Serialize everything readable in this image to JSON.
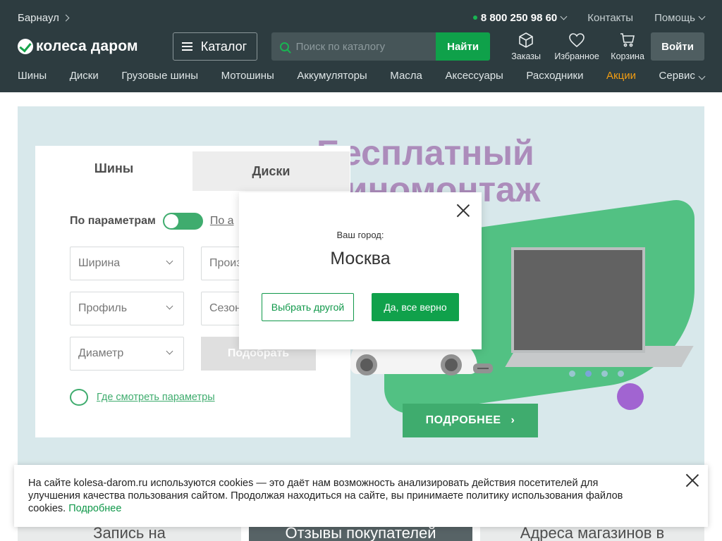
{
  "header": {
    "city": "Барнаул",
    "phone": "8 800 250 98 60",
    "contacts": "Контакты",
    "help": "Помощь",
    "logo_text": "колеса даром",
    "catalog": "Каталог",
    "search_placeholder": "Поиск по каталогу",
    "search_button": "Найти",
    "icons": [
      {
        "label": "Заказы",
        "icon": "box-icon"
      },
      {
        "label": "Избранное",
        "icon": "heart-icon"
      },
      {
        "label": "Корзина",
        "icon": "cart-icon"
      }
    ],
    "login": "Войти"
  },
  "nav": [
    "Шины",
    "Диски",
    "Грузовые шины",
    "Мотошины",
    "Аккумуляторы",
    "Масла",
    "Аксессуары",
    "Расходники",
    "Акции",
    "Сервис"
  ],
  "banner": {
    "title_line1": "Бесплатный",
    "title_line2": "шиномонтаж",
    "more_button": "ПОДРОБНЕЕ"
  },
  "filter": {
    "tab_tires": "Шины",
    "tab_disks": "Диски",
    "by_params": "По параметрам",
    "by_auto": "По а",
    "width": "Ширина",
    "maker": "Произ",
    "profile": "Профиль",
    "season": "Сезон",
    "diameter": "Диаметр",
    "pick": "Подобрать",
    "where_params": "Где смотреть параметры"
  },
  "modal": {
    "label": "Ваш город:",
    "city": "Москва",
    "other": "Выбрать другой",
    "confirm": "Да, все верно"
  },
  "cookie": {
    "text": "На сайте kolesa-darom.ru используются cookies — это даёт нам возможность анализировать действия посетителей для улучшения качества пользования сайтом. Продолжая находиться на сайте, вы принимаете политику использования файлов cookies.",
    "more": "Подробнее"
  },
  "cards": [
    "Запись на",
    "Отзывы покупателей",
    "Адреса магазинов в"
  ],
  "colors": {
    "header_bg": "#2d3c40",
    "accent_green": "#10984a",
    "promo_orange": "#f29d12"
  }
}
